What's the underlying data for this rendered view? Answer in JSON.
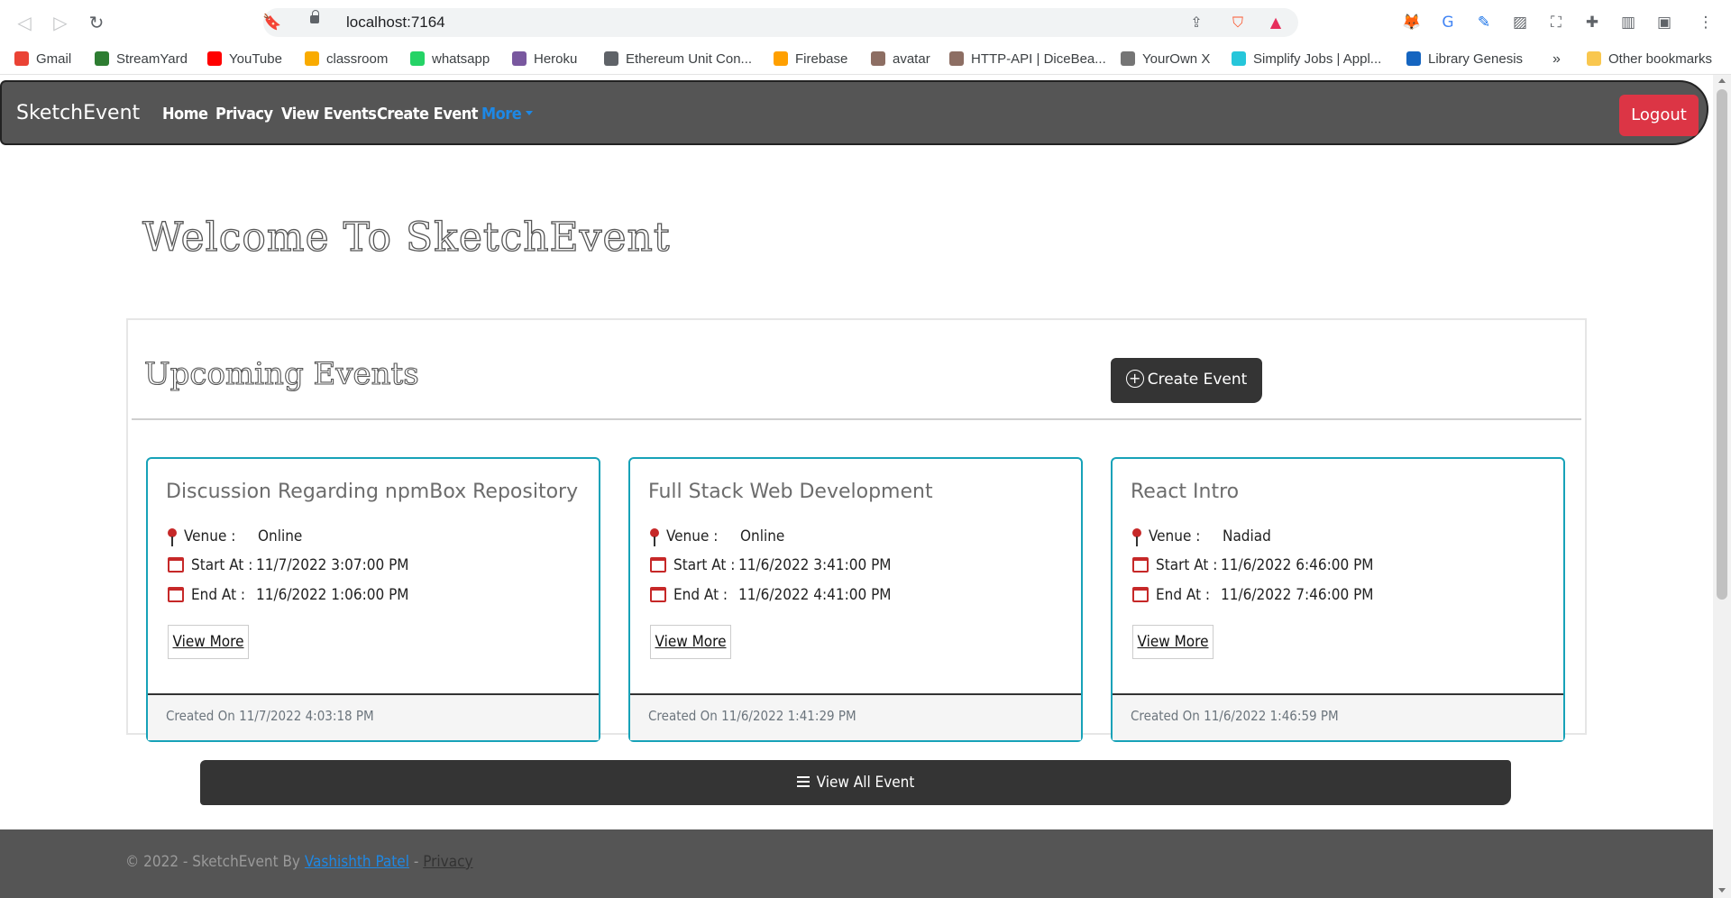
{
  "browser": {
    "url": "localhost:7164",
    "bookmarks": [
      {
        "label": "Gmail",
        "icon": "gmail-icon",
        "color": "#ea4335"
      },
      {
        "label": "StreamYard",
        "icon": "streamyard-icon",
        "color": "#2e7d32"
      },
      {
        "label": "YouTube",
        "icon": "youtube-icon",
        "color": "#ff0000"
      },
      {
        "label": "classroom",
        "icon": "classroom-icon",
        "color": "#f9ab00"
      },
      {
        "label": "whatsapp",
        "icon": "whatsapp-icon",
        "color": "#25d366"
      },
      {
        "label": "Heroku",
        "icon": "heroku-icon",
        "color": "#79589f"
      },
      {
        "label": "Ethereum Unit Con...",
        "icon": "globe-icon",
        "color": "#5f6368"
      },
      {
        "label": "Firebase",
        "icon": "firebase-icon",
        "color": "#ffa000"
      },
      {
        "label": "avatar",
        "icon": "avatar-icon",
        "color": "#8d6e63"
      },
      {
        "label": "HTTP-API | DiceBea...",
        "icon": "avatar-icon",
        "color": "#8d6e63"
      },
      {
        "label": "YourOwn X",
        "icon": "yourownx-icon",
        "color": "#757575"
      },
      {
        "label": "Simplify Jobs | Appl...",
        "icon": "simplify-icon",
        "color": "#26c6da"
      },
      {
        "label": "Library Genesis",
        "icon": "libgen-icon",
        "color": "#1565c0"
      }
    ],
    "overflow": "»",
    "other_bookmarks": "Other bookmarks"
  },
  "navbar": {
    "brand": "SketchEvent",
    "links": [
      "Home",
      "Privacy",
      "View Events",
      "Create Event"
    ],
    "more": "More",
    "logout": "Logout"
  },
  "main": {
    "welcome": "Welcome To SketchEvent",
    "section_title": "Upcoming Events",
    "create_button": "Create Event",
    "view_all": "View All Event",
    "labels": {
      "venue": "Venue :",
      "start": "Start At :",
      "end": "End At :"
    },
    "view_more": "View More",
    "events": [
      {
        "title": "Discussion Regarding npmBox Repository",
        "venue": "Online",
        "start": "11/7/2022 3:07:00 PM",
        "end": "11/6/2022 1:06:00 PM",
        "created": "Created On 11/7/2022 4:03:18 PM"
      },
      {
        "title": "Full Stack Web Development",
        "venue": "Online",
        "start": "11/6/2022 3:41:00 PM",
        "end": "11/6/2022 4:41:00 PM",
        "created": "Created On 11/6/2022 1:41:29 PM"
      },
      {
        "title": "React Intro",
        "venue": "Nadiad",
        "start": "11/6/2022 6:46:00 PM",
        "end": "11/6/2022 7:46:00 PM",
        "created": "Created On 11/6/2022 1:46:59 PM"
      }
    ]
  },
  "footer": {
    "prefix": "© 2022 - SketchEvent By ",
    "author": "Vashishth Patel",
    "sep": " - ",
    "privacy": "Privacy"
  },
  "colors": {
    "navbar": "#555555",
    "logout": "#dc3545",
    "card_border": "#17a2b8",
    "link": "#1e88e5"
  }
}
